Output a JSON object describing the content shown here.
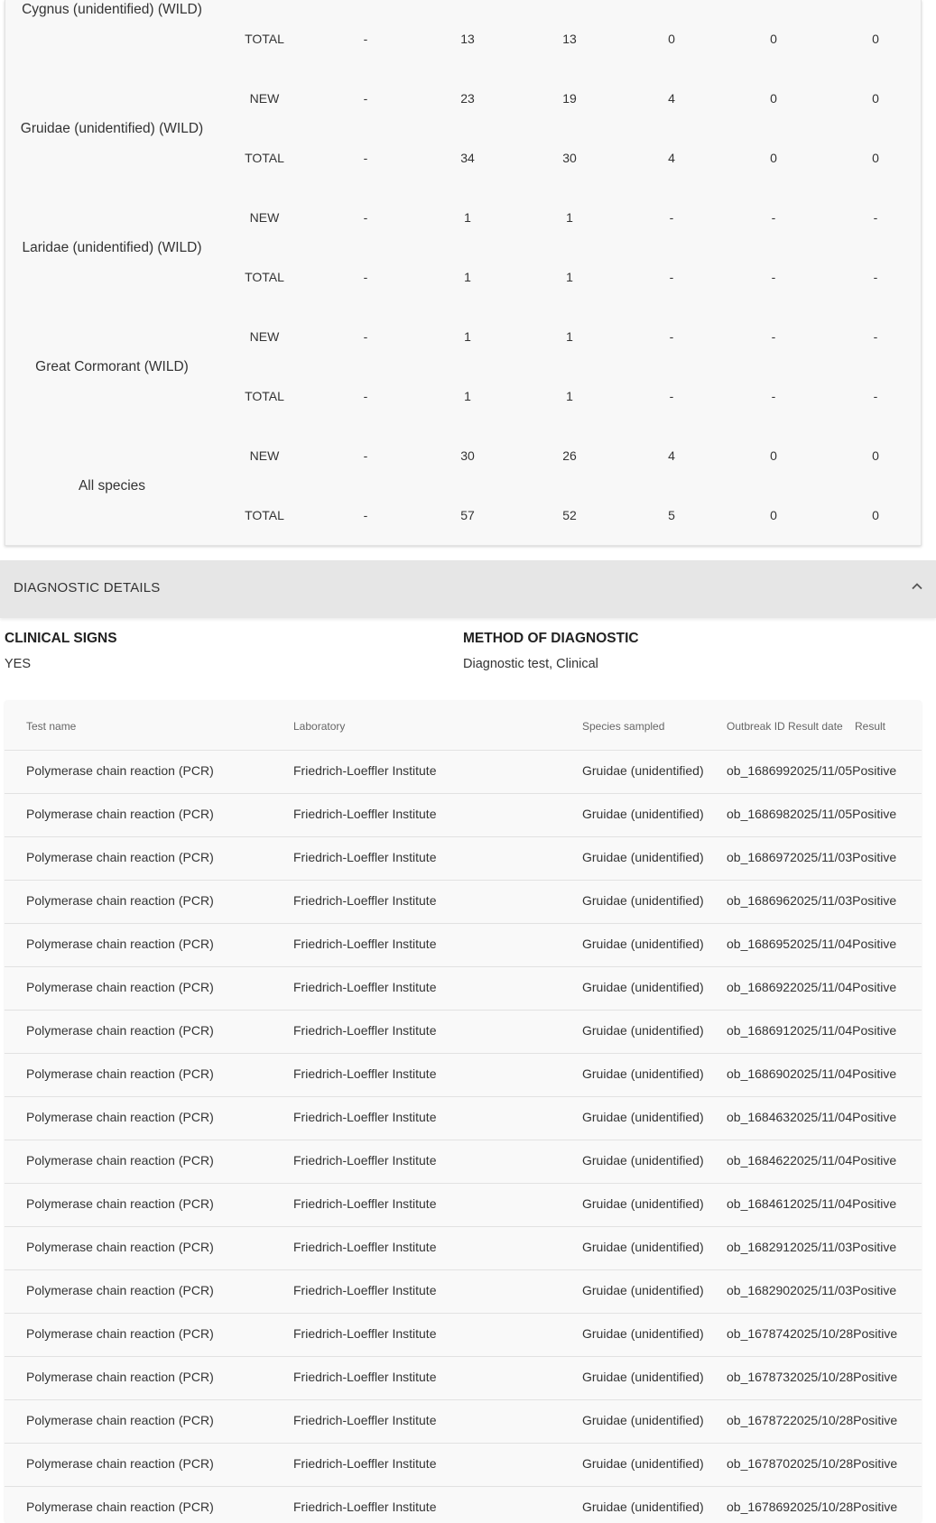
{
  "summary": {
    "species": [
      {
        "name": "Cygnus (unidentified) (WILD)",
        "rows": [
          {
            "type": "TOTAL",
            "values": [
              "-",
              "13",
              "13",
              "0",
              "0",
              "0"
            ]
          }
        ]
      },
      {
        "name": "Gruidae (unidentified) (WILD)",
        "rows": [
          {
            "type": "NEW",
            "values": [
              "-",
              "23",
              "19",
              "4",
              "0",
              "0"
            ]
          },
          {
            "type": "TOTAL",
            "values": [
              "-",
              "34",
              "30",
              "4",
              "0",
              "0"
            ]
          }
        ]
      },
      {
        "name": "Laridae (unidentified) (WILD)",
        "rows": [
          {
            "type": "NEW",
            "values": [
              "-",
              "1",
              "1",
              "-",
              "-",
              "-"
            ]
          },
          {
            "type": "TOTAL",
            "values": [
              "-",
              "1",
              "1",
              "-",
              "-",
              "-"
            ]
          }
        ]
      },
      {
        "name": "Great Cormorant (WILD)",
        "rows": [
          {
            "type": "NEW",
            "values": [
              "-",
              "1",
              "1",
              "-",
              "-",
              "-"
            ]
          },
          {
            "type": "TOTAL",
            "values": [
              "-",
              "1",
              "1",
              "-",
              "-",
              "-"
            ]
          }
        ]
      },
      {
        "name": "All species",
        "rows": [
          {
            "type": "NEW",
            "values": [
              "-",
              "30",
              "26",
              "4",
              "0",
              "0"
            ]
          },
          {
            "type": "TOTAL",
            "values": [
              "-",
              "57",
              "52",
              "5",
              "0",
              "0"
            ]
          }
        ]
      }
    ]
  },
  "diagnostic": {
    "title": "DIAGNOSTIC DETAILS",
    "toggle_icon": "chevron-up-icon",
    "clinical_signs_label": "CLINICAL SIGNS",
    "clinical_signs_value": "YES",
    "method_label": "METHOD OF DIAGNOSTIC",
    "method_value": "Diagnostic test, Clinical",
    "table": {
      "headers": {
        "test_name": "Test name",
        "laboratory": "Laboratory",
        "species_sampled": "Species sampled",
        "outbreak_id": "Outbreak ID",
        "result_date": "Result date",
        "result": "Result"
      },
      "rows": [
        {
          "test_name": "Polymerase chain reaction (PCR)",
          "laboratory": "Friedrich-Loeffler Institute",
          "species": "Gruidae (unidentified)",
          "outbreak_date_result": "ob_1686992025/11/05Positive"
        },
        {
          "test_name": "Polymerase chain reaction (PCR)",
          "laboratory": "Friedrich-Loeffler Institute",
          "species": "Gruidae (unidentified)",
          "outbreak_date_result": "ob_1686982025/11/05Positive"
        },
        {
          "test_name": "Polymerase chain reaction (PCR)",
          "laboratory": "Friedrich-Loeffler Institute",
          "species": "Gruidae (unidentified)",
          "outbreak_date_result": "ob_1686972025/11/03Positive"
        },
        {
          "test_name": "Polymerase chain reaction (PCR)",
          "laboratory": "Friedrich-Loeffler Institute",
          "species": "Gruidae (unidentified)",
          "outbreak_date_result": "ob_1686962025/11/03Positive"
        },
        {
          "test_name": "Polymerase chain reaction (PCR)",
          "laboratory": "Friedrich-Loeffler Institute",
          "species": "Gruidae (unidentified)",
          "outbreak_date_result": "ob_1686952025/11/04Positive"
        },
        {
          "test_name": "Polymerase chain reaction (PCR)",
          "laboratory": "Friedrich-Loeffler Institute",
          "species": "Gruidae (unidentified)",
          "outbreak_date_result": "ob_1686922025/11/04Positive"
        },
        {
          "test_name": "Polymerase chain reaction (PCR)",
          "laboratory": "Friedrich-Loeffler Institute",
          "species": "Gruidae (unidentified)",
          "outbreak_date_result": "ob_1686912025/11/04Positive"
        },
        {
          "test_name": "Polymerase chain reaction (PCR)",
          "laboratory": "Friedrich-Loeffler Institute",
          "species": "Gruidae (unidentified)",
          "outbreak_date_result": "ob_1686902025/11/04Positive"
        },
        {
          "test_name": "Polymerase chain reaction (PCR)",
          "laboratory": "Friedrich-Loeffler Institute",
          "species": "Gruidae (unidentified)",
          "outbreak_date_result": "ob_1684632025/11/04Positive"
        },
        {
          "test_name": "Polymerase chain reaction (PCR)",
          "laboratory": "Friedrich-Loeffler Institute",
          "species": "Gruidae (unidentified)",
          "outbreak_date_result": "ob_1684622025/11/04Positive"
        },
        {
          "test_name": "Polymerase chain reaction (PCR)",
          "laboratory": "Friedrich-Loeffler Institute",
          "species": "Gruidae (unidentified)",
          "outbreak_date_result": "ob_1684612025/11/04Positive"
        },
        {
          "test_name": "Polymerase chain reaction (PCR)",
          "laboratory": "Friedrich-Loeffler Institute",
          "species": "Gruidae (unidentified)",
          "outbreak_date_result": "ob_1682912025/11/03Positive"
        },
        {
          "test_name": "Polymerase chain reaction (PCR)",
          "laboratory": "Friedrich-Loeffler Institute",
          "species": "Gruidae (unidentified)",
          "outbreak_date_result": "ob_1682902025/11/03Positive"
        },
        {
          "test_name": "Polymerase chain reaction (PCR)",
          "laboratory": "Friedrich-Loeffler Institute",
          "species": "Gruidae (unidentified)",
          "outbreak_date_result": "ob_1678742025/10/28Positive"
        },
        {
          "test_name": "Polymerase chain reaction (PCR)",
          "laboratory": "Friedrich-Loeffler Institute",
          "species": "Gruidae (unidentified)",
          "outbreak_date_result": "ob_1678732025/10/28Positive"
        },
        {
          "test_name": "Polymerase chain reaction (PCR)",
          "laboratory": "Friedrich-Loeffler Institute",
          "species": "Gruidae (unidentified)",
          "outbreak_date_result": "ob_1678722025/10/28Positive"
        },
        {
          "test_name": "Polymerase chain reaction (PCR)",
          "laboratory": "Friedrich-Loeffler Institute",
          "species": "Gruidae (unidentified)",
          "outbreak_date_result": "ob_1678702025/10/28Positive"
        },
        {
          "test_name": "Polymerase chain reaction (PCR)",
          "laboratory": "Friedrich-Loeffler Institute",
          "species": "Gruidae (unidentified)",
          "outbreak_date_result": "ob_1678692025/10/28Positive"
        }
      ]
    }
  }
}
